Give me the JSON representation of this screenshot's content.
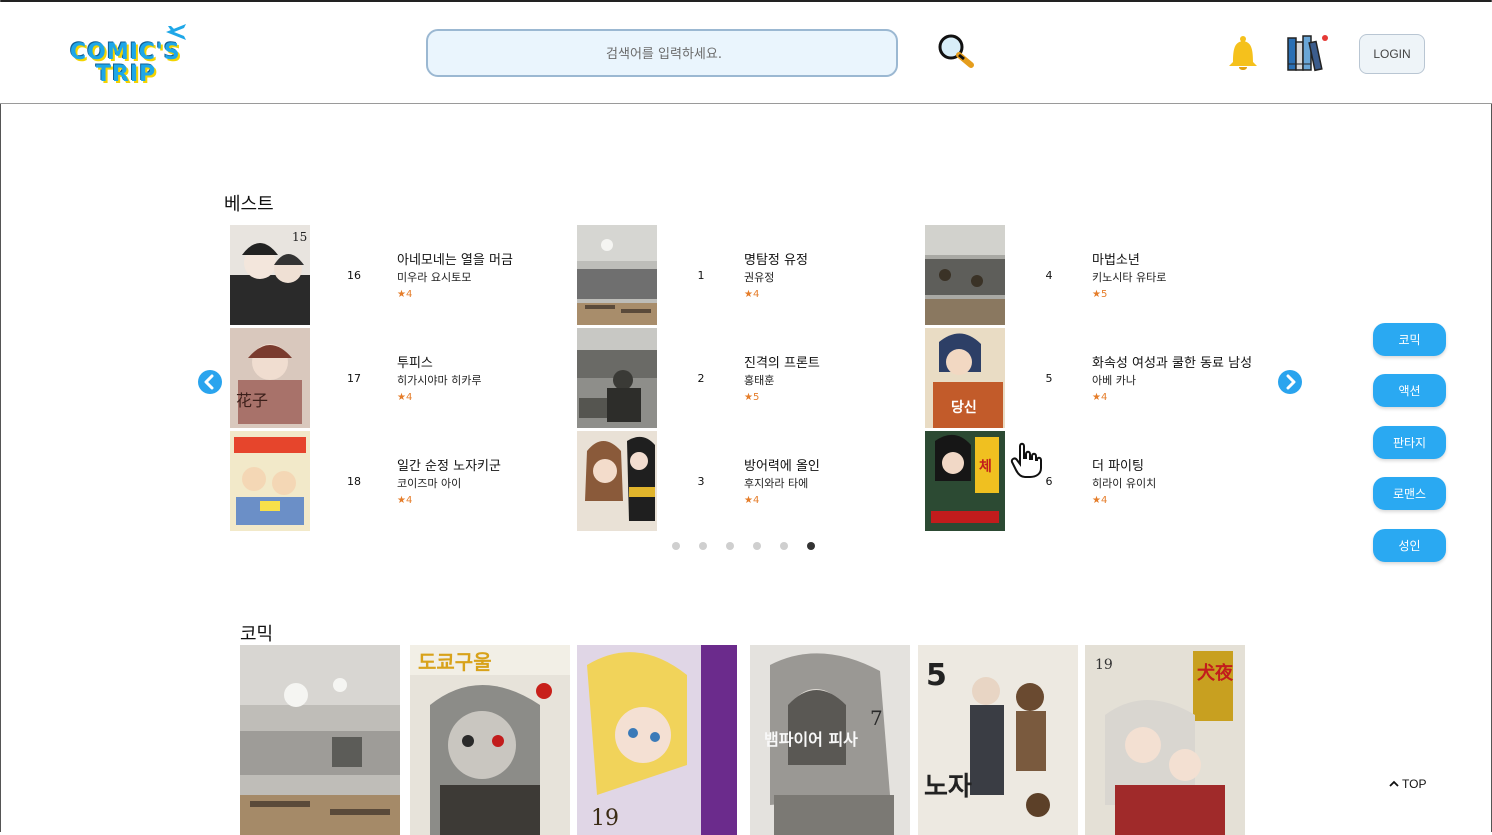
{
  "header": {
    "logo_line1": "COMIC'S",
    "logo_line2": "TRIP",
    "search_placeholder": "검색어를 입력하세요.",
    "login_label": "LOGIN",
    "colors": {
      "accent": "#2aa9f2",
      "logo": "#1ea7e8",
      "bell": "#f5c11c",
      "badge": "#e53935"
    }
  },
  "best": {
    "title": "베스트",
    "columns": [
      [
        {
          "rank": "16",
          "name": "아네모네는 열을 머금",
          "author": "미우라 요시토모",
          "rating": "4"
        },
        {
          "rank": "17",
          "name": "투피스",
          "author": "히가시야마 히카루",
          "rating": "4"
        },
        {
          "rank": "18",
          "name": "일간 순정 노자키군",
          "author": "코이즈마 아이",
          "rating": "4"
        }
      ],
      [
        {
          "rank": "1",
          "name": "명탐정 유정",
          "author": "권유정",
          "rating": "4"
        },
        {
          "rank": "2",
          "name": "진격의 프론트",
          "author": "홍태훈",
          "rating": "5"
        },
        {
          "rank": "3",
          "name": "방어력에 올인",
          "author": "후지와라 타에",
          "rating": "4"
        }
      ],
      [
        {
          "rank": "4",
          "name": "마법소년",
          "author": "키노시타 유타로",
          "rating": "5"
        },
        {
          "rank": "5",
          "name": "화속성 여성과 쿨한 동료 남성",
          "author": "아베 카나",
          "rating": "4"
        },
        {
          "rank": "6",
          "name": "더 파이팅",
          "author": "히라이 유이치",
          "rating": "4"
        }
      ]
    ],
    "pagination": {
      "total": 6,
      "active": 6
    }
  },
  "categories": [
    "코믹",
    "액션",
    "판타지",
    "로맨스",
    "성인"
  ],
  "comic": {
    "title": "코믹",
    "cards": [
      "office-photo",
      "manga-cover-1",
      "manga-cover-2",
      "manga-cover-3",
      "manga-cover-4",
      "manga-cover-5"
    ]
  },
  "top_label": "TOP"
}
